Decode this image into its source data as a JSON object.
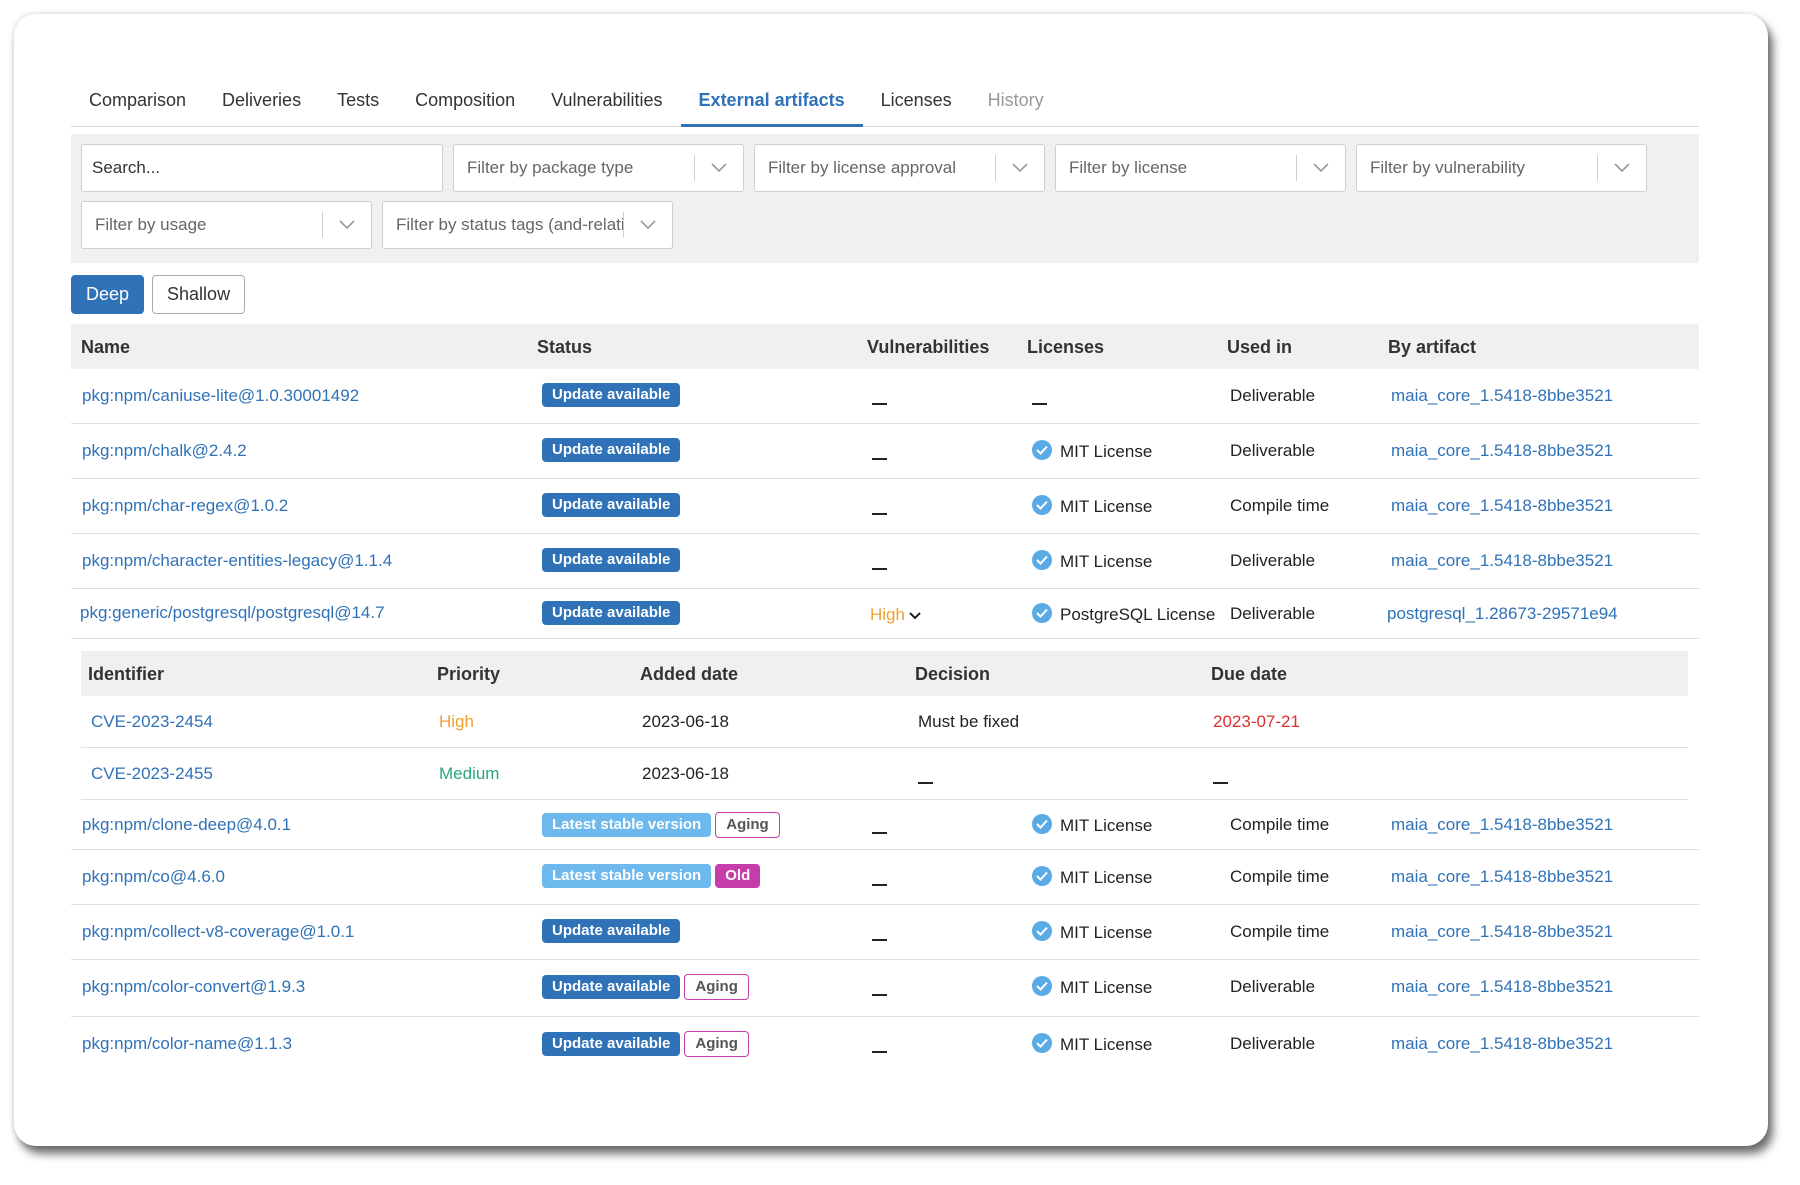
{
  "tabs": [
    {
      "label": "Comparison",
      "state": "normal"
    },
    {
      "label": "Deliveries",
      "state": "normal"
    },
    {
      "label": "Tests",
      "state": "normal"
    },
    {
      "label": "Composition",
      "state": "normal"
    },
    {
      "label": "Vulnerabilities",
      "state": "normal"
    },
    {
      "label": "External artifacts",
      "state": "active"
    },
    {
      "label": "Licenses",
      "state": "normal"
    },
    {
      "label": "History",
      "state": "disabled"
    }
  ],
  "filters": {
    "search_placeholder": "Search...",
    "package_type": "Filter by package type",
    "license_approval": "Filter by license approval",
    "license": "Filter by license",
    "vulnerability": "Filter by vulnerability",
    "usage": "Filter by usage",
    "status_tags": "Filter by status tags (and-relation)"
  },
  "mode_toggle": {
    "deep": "Deep",
    "shallow": "Shallow",
    "selected": "Deep"
  },
  "table": {
    "headers": {
      "name": "Name",
      "status": "Status",
      "vulnerabilities": "Vulnerabilities",
      "licenses": "Licenses",
      "used_in": "Used in",
      "by_artifact": "By artifact"
    },
    "rows_top": [
      {
        "name": "pkg:npm/caniuse-lite@1.0.30001492",
        "status": [
          "Update available"
        ],
        "aging": "",
        "vuln": "",
        "license": "",
        "used_in": "Deliverable",
        "artifact": "maia_core_1.5418-8bbe3521"
      },
      {
        "name": "pkg:npm/chalk@2.4.2",
        "status": [
          "Update available"
        ],
        "aging": "",
        "vuln": "",
        "license": "MIT License",
        "used_in": "Deliverable",
        "artifact": "maia_core_1.5418-8bbe3521"
      },
      {
        "name": "pkg:npm/char-regex@1.0.2",
        "status": [
          "Update available"
        ],
        "aging": "",
        "vuln": "",
        "license": "MIT License",
        "used_in": "Compile time",
        "artifact": "maia_core_1.5418-8bbe3521"
      },
      {
        "name": "pkg:npm/character-entities-legacy@1.1.4",
        "status": [
          "Update available"
        ],
        "aging": "",
        "vuln": "",
        "license": "MIT License",
        "used_in": "Deliverable",
        "artifact": "maia_core_1.5418-8bbe3521"
      },
      {
        "name": "pkg:generic/postgresql/postgresql@14.7",
        "status": [
          "Update available"
        ],
        "aging": "",
        "vuln": "High",
        "license": "PostgreSQL License",
        "used_in": "Deliverable",
        "artifact": "postgresql_1.28673-29571e94"
      }
    ],
    "vuln_detail": {
      "headers": {
        "identifier": "Identifier",
        "priority": "Priority",
        "added": "Added date",
        "decision": "Decision",
        "due": "Due date"
      },
      "rows": [
        {
          "id": "CVE-2023-2454",
          "priority": "High",
          "added": "2023-06-18",
          "decision": "Must be fixed",
          "due": "2023-07-21"
        },
        {
          "id": "CVE-2023-2455",
          "priority": "Medium",
          "added": "2023-06-18",
          "decision": "",
          "due": ""
        }
      ]
    },
    "rows_bottom": [
      {
        "name": "pkg:npm/clone-deep@4.0.1",
        "badge": "Latest stable version",
        "badge_type": "latest",
        "tag": "Aging",
        "tag_type": "aging",
        "license": "MIT License",
        "used_in": "Compile time",
        "artifact": "maia_core_1.5418-8bbe3521"
      },
      {
        "name": "pkg:npm/co@4.6.0",
        "badge": "Latest stable version",
        "badge_type": "latest",
        "tag": "Old",
        "tag_type": "old",
        "license": "MIT License",
        "used_in": "Compile time",
        "artifact": "maia_core_1.5418-8bbe3521"
      },
      {
        "name": "pkg:npm/collect-v8-coverage@1.0.1",
        "badge": "Update available",
        "badge_type": "update",
        "tag": "",
        "tag_type": "",
        "license": "MIT License",
        "used_in": "Compile time",
        "artifact": "maia_core_1.5418-8bbe3521"
      },
      {
        "name": "pkg:npm/color-convert@1.9.3",
        "badge": "Update available",
        "badge_type": "update",
        "tag": "Aging",
        "tag_type": "aging",
        "license": "MIT License",
        "used_in": "Deliverable",
        "artifact": "maia_core_1.5418-8bbe3521"
      },
      {
        "name": "pkg:npm/color-name@1.1.3",
        "badge": "Update available",
        "badge_type": "update",
        "tag": "Aging",
        "tag_type": "aging",
        "license": "MIT License",
        "used_in": "Deliverable",
        "artifact": "maia_core_1.5418-8bbe3521"
      }
    ]
  },
  "colors": {
    "accent": "#2f72b8",
    "high": "#f0a030",
    "medium": "#2aa87a",
    "due_overdue": "#d9302c",
    "old_tag": "#c53da8",
    "latest_badge": "#6db8ec"
  }
}
